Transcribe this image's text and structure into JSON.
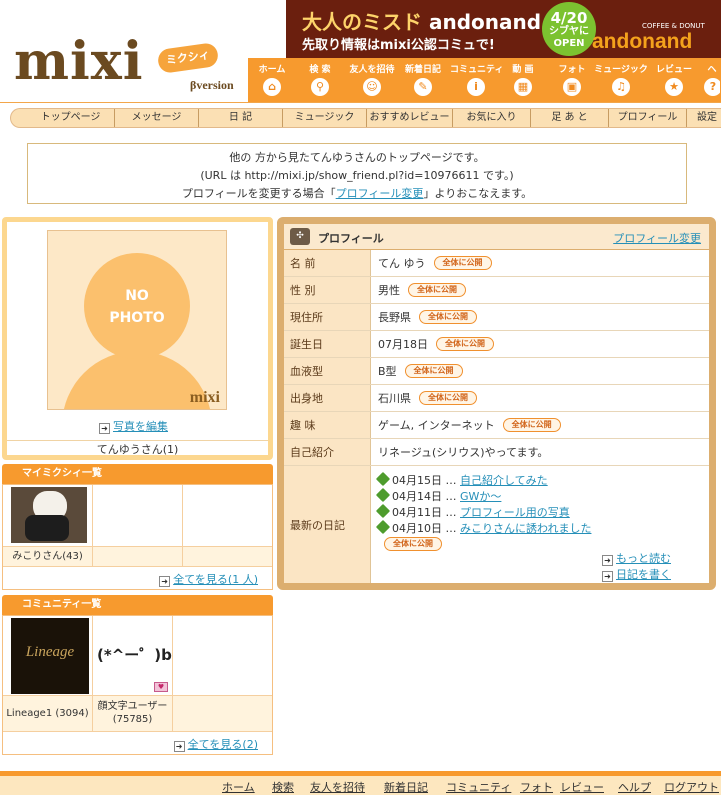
{
  "header": {
    "logo": "mixi",
    "logo_badge": "ミクシィ",
    "logo_version": "βversion",
    "banner": {
      "line1_prefix": "大人のミスド",
      "line1_brand": "andonand",
      "line2": "先取り情報はmixi公認コミュで!",
      "open_date": "4/20",
      "open_text": "シブヤに OPEN",
      "tagline": "COFFEE & DONUT",
      "brand_logo": "andonand"
    },
    "top_nav": [
      {
        "label": "ホーム",
        "icon": "home-icon",
        "glyph": "⌂"
      },
      {
        "label": "検 索",
        "icon": "search-icon",
        "glyph": "⚲"
      },
      {
        "label": "友人を招待",
        "icon": "smile-icon",
        "glyph": "☺"
      },
      {
        "label": "新着日記",
        "icon": "pencil-icon",
        "glyph": "✎"
      },
      {
        "label": "コミュニティ",
        "icon": "info-icon",
        "glyph": "i"
      },
      {
        "label": "動 画",
        "icon": "film-icon",
        "glyph": "▦"
      },
      {
        "label": "フォト",
        "icon": "photo-icon",
        "glyph": "▣"
      },
      {
        "label": "ミュージック",
        "icon": "music-icon",
        "glyph": "♫"
      },
      {
        "label": "レビュー",
        "icon": "star-icon",
        "glyph": "★"
      },
      {
        "label": "ヘ",
        "icon": "help-icon",
        "glyph": "?"
      }
    ]
  },
  "menubar": [
    "トップページ",
    "メッセージ",
    "日 記",
    "ミュージック",
    "おすすめレビュー",
    "お気に入り",
    "足 あ と",
    "プロフィール",
    "設定"
  ],
  "notice": {
    "line1": "他の 方から見たてんゆうさんのトップページです。",
    "line2": "(URL は http://mixi.jp/show_friend.pl?id=10976611 です。)",
    "line3_prefix": "プロフィールを変更する場合「",
    "line3_link": "プロフィール変更",
    "line3_suffix": "」よりおこなえます。"
  },
  "photo_box": {
    "no_photo_1": "NO",
    "no_photo_2": "PHOTO",
    "watermark": "mixi",
    "edit_link": "写真を編集",
    "user_name": "てんゆうさん(1)"
  },
  "friends": {
    "title": "マイミクシィ一覧",
    "items": [
      {
        "name": "みこりさん(43)"
      }
    ],
    "see_all": "全てを見る(1 人)"
  },
  "communities": {
    "title": "コミュニティ一覧",
    "items": [
      {
        "name": "Lineage1 (3094)",
        "thumb_text": "Lineage"
      },
      {
        "name": "顔文字ユーザー (75785)",
        "thumb_text": "(*^ー゜)b"
      }
    ],
    "see_all": "全てを見る(2)"
  },
  "profile": {
    "title": "プロフィール",
    "edit_link": "プロフィール変更",
    "public_badge": "全体に公開",
    "rows": [
      {
        "label": "名 前",
        "value": "てん ゆう",
        "public": true
      },
      {
        "label": "性 別",
        "value": "男性",
        "public": true
      },
      {
        "label": "現住所",
        "value": "長野県",
        "public": true
      },
      {
        "label": "誕生日",
        "value": "07月18日",
        "public": true
      },
      {
        "label": "血液型",
        "value": "B型",
        "public": true
      },
      {
        "label": "出身地",
        "value": "石川県",
        "public": true
      },
      {
        "label": "趣 味",
        "value": "ゲーム, インターネット",
        "public": true
      },
      {
        "label": "自己紹介",
        "value": "リネージュ(シリウス)やってます。",
        "public": false
      }
    ],
    "diary_label": "最新の日記",
    "diary": [
      {
        "date": "04月15日",
        "title": "自己紹介してみた"
      },
      {
        "date": "04月14日",
        "title": "GWか～"
      },
      {
        "date": "04月11日",
        "title": "プロフィール用の写真"
      },
      {
        "date": "04月10日",
        "title": "みこりさんに誘われました"
      }
    ],
    "more_link": "もっと読む",
    "write_link": "日記を書く"
  },
  "footer": [
    "ホーム",
    "検索",
    "友人を招待",
    "新着日記",
    "コミュニティ",
    "フォト",
    "レビュー",
    "ヘルプ",
    "ログアウト"
  ],
  "colors": {
    "accent": "#f79a2e",
    "link": "#258fb8",
    "label_bg": "#fbe5c4"
  }
}
